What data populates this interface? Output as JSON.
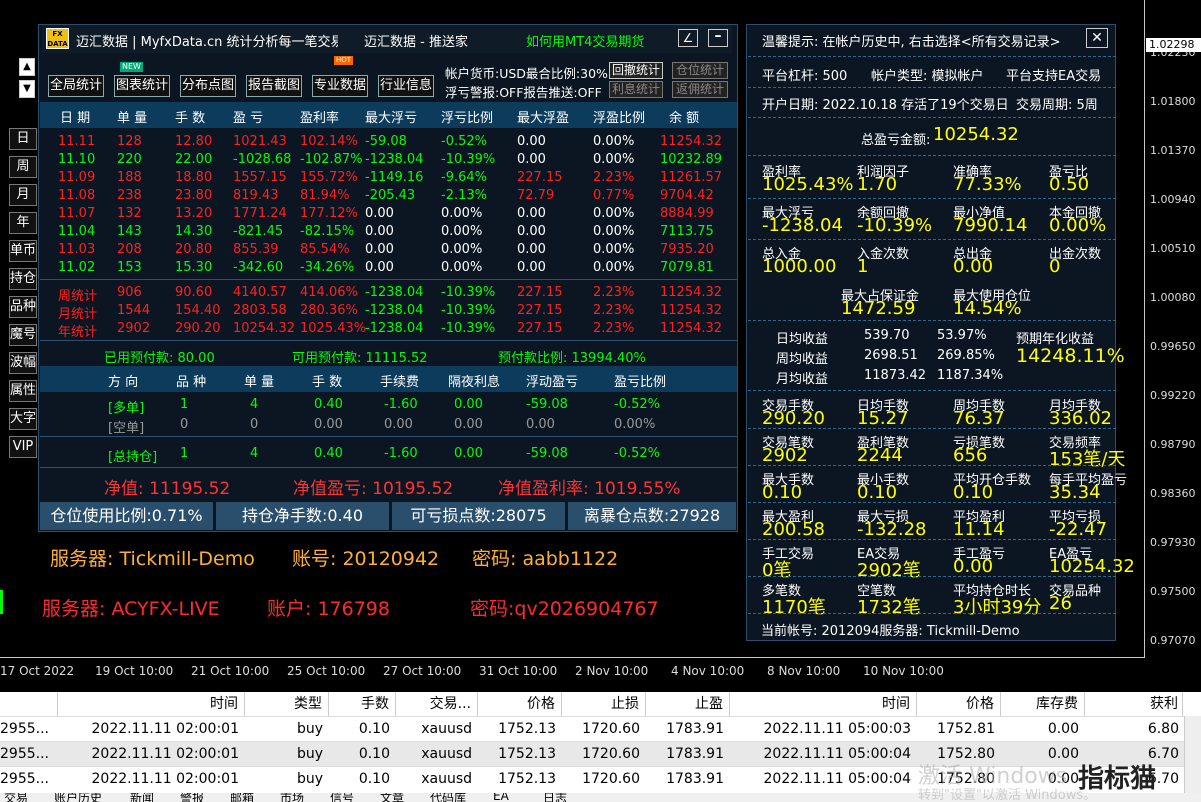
{
  "window": {
    "title": "迈汇数据 | MyfxData.cn  统计分析每一笔交易",
    "title2": "迈汇数据 - 推送家",
    "link": "如何用MT4交易期货",
    "logo": "FX\nDATA"
  },
  "price_axis": [
    "1.02298",
    "1.02230",
    "1.01800",
    "1.01370",
    "1.00940",
    "1.00510",
    "1.00080",
    "0.99650",
    "0.99220",
    "0.98790",
    "0.98360",
    "0.97930",
    "0.97500",
    "0.97070"
  ],
  "time_axis": [
    "17 Oct 2022",
    "19 Oct 10:00",
    "21 Oct 10:00",
    "25 Oct 10:00",
    "27 Oct 10:00",
    "31 Oct 10:00",
    "2 Nov 10:00",
    "4 Nov 10:00",
    "8 Nov 10:00",
    "10 Nov 10:00"
  ],
  "side_buttons": [
    "日",
    "周",
    "月",
    "年",
    "单币",
    "持仓",
    "品种",
    "魔号",
    "波幅",
    "属性",
    "大字",
    "VIP"
  ],
  "toolbar": {
    "buttons": [
      "全局统计",
      "图表统计",
      "分布点图",
      "报告截图",
      "专业数据",
      "行业信息"
    ],
    "new_badge": "NEW",
    "hot_badge": "HOT",
    "account_currency": "帐户货币:USD最合比例:30%",
    "float_warn": "浮亏警报:OFF报告推送:OFF",
    "btn_drawdown": "回撤统计",
    "btn_position": "仓位统计",
    "btn_profit": "利息统计",
    "btn_return": "返佣统计"
  },
  "stats_table": {
    "headers": [
      "日 期",
      "单 量",
      "手 数",
      "盈 亏",
      "盈利率",
      "最大浮亏",
      "浮亏比例",
      "最大浮盈",
      "浮盈比例",
      "余 额"
    ],
    "rows": [
      [
        "11.11",
        "128",
        "12.80",
        "1021.43",
        "102.14%",
        "-59.08",
        "-0.52%",
        "0.00",
        "0.00%",
        "11254.32"
      ],
      [
        "11.10",
        "220",
        "22.00",
        "-1028.68",
        "-102.87%",
        "-1238.04",
        "-10.39%",
        "0.00",
        "0.00%",
        "10232.89"
      ],
      [
        "11.09",
        "188",
        "18.80",
        "1557.15",
        "155.72%",
        "-1149.16",
        "-9.64%",
        "227.15",
        "2.23%",
        "11261.57"
      ],
      [
        "11.08",
        "238",
        "23.80",
        "819.43",
        "81.94%",
        "-205.43",
        "-2.13%",
        "72.79",
        "0.77%",
        "9704.42"
      ],
      [
        "11.07",
        "132",
        "13.20",
        "1771.24",
        "177.12%",
        "0.00",
        "0.00%",
        "0.00",
        "0.00%",
        "8884.99"
      ],
      [
        "11.04",
        "143",
        "14.30",
        "-821.45",
        "-82.15%",
        "0.00",
        "0.00%",
        "0.00",
        "0.00%",
        "7113.75"
      ],
      [
        "11.03",
        "208",
        "20.80",
        "855.39",
        "85.54%",
        "0.00",
        "0.00%",
        "0.00",
        "0.00%",
        "7935.20"
      ],
      [
        "11.02",
        "153",
        "15.30",
        "-342.60",
        "-34.26%",
        "0.00",
        "0.00%",
        "0.00",
        "0.00%",
        "7079.81"
      ]
    ],
    "summary": [
      [
        "周统计",
        "906",
        "90.60",
        "4140.57",
        "414.06%",
        "-1238.04",
        "-10.39%",
        "227.15",
        "2.23%",
        "11254.32"
      ],
      [
        "月统计",
        "1544",
        "154.40",
        "2803.58",
        "280.36%",
        "-1238.04",
        "-10.39%",
        "227.15",
        "2.23%",
        "11254.32"
      ],
      [
        "年统计",
        "2902",
        "290.20",
        "10254.32",
        "1025.43%",
        "-1238.04",
        "-10.39%",
        "227.15",
        "2.23%",
        "11254.32"
      ]
    ],
    "margin_used": "已用预付款: 80.00",
    "margin_free": "可用预付款: 11115.52",
    "margin_ratio": "预付款比例: 13994.40%"
  },
  "position_table": {
    "headers": [
      "方 向",
      "品 种",
      "单 量",
      "手 数",
      "手续费",
      "隔夜利息",
      "浮动盈亏",
      "盈亏比例"
    ],
    "rows": [
      [
        "[多单]",
        "1",
        "4",
        "0.40",
        "-1.60",
        "0.00",
        "-59.08",
        "-0.52%"
      ],
      [
        "[空单]",
        "0",
        "0",
        "0.00",
        "0.00",
        "0.00",
        "0.00",
        "0.00%"
      ],
      [
        "[总持仓]",
        "1",
        "4",
        "0.40",
        "-1.60",
        "0.00",
        "-59.08",
        "-0.52%"
      ]
    ]
  },
  "net": {
    "equity": "净值: 11195.52",
    "equity_profit": "净值盈亏: 10195.52",
    "equity_rate": "净值盈利率: 1019.55%"
  },
  "bottom_stats": [
    "仓位使用比例:0.71%",
    "持仓净手数:0.40",
    "可亏损点数:28075",
    "离暴仓点数:27928"
  ],
  "server1": {
    "server": "服务器: Tickmill-Demo",
    "account": "账号:  20120942",
    "password": "密码: aabb1122"
  },
  "server2": {
    "server": "服务器: ACYFX-LIVE",
    "account": "账户: 176798",
    "password": "密码:qv2026904767"
  },
  "right": {
    "tip": "温馨提示: 在帐户历史中, 右击选择<所有交易记录>",
    "close": "✕",
    "leverage": "平台杠杆: 500",
    "acct_type": "帐户类型: 模拟帐户",
    "ea": "平台支持EA交易",
    "open_date": "开户日期: 2022.10.18 存活了19个交易日",
    "period": "交易周期: 5周",
    "total_label": "总盈亏金额:",
    "total_value": "10254.32",
    "blocks": [
      [
        [
          "盈利率",
          "1025.43%"
        ],
        [
          "利润因子",
          "1.70"
        ],
        [
          "准确率",
          "77.33%"
        ],
        [
          "盈亏比",
          "0.50"
        ]
      ],
      [
        [
          "最大浮亏",
          "-1238.04"
        ],
        [
          "余额回撤",
          "-10.39%"
        ],
        [
          "最小净值",
          "7990.14"
        ],
        [
          "本金回撤",
          "0.00%"
        ]
      ],
      [
        [
          "总入金",
          "1000.00"
        ],
        [
          "入金次数",
          "1"
        ],
        [
          "总出金",
          "0.00"
        ],
        [
          "出金次数",
          "0"
        ]
      ]
    ],
    "max_margin_label": "最大占保证金",
    "max_margin": "1472.59",
    "max_pos_label": "最大使用仓位",
    "max_pos": "14.54%",
    "avg": [
      [
        "日均收益",
        "539.70",
        "53.97%"
      ],
      [
        "周均收益",
        "2698.51",
        "269.85%"
      ],
      [
        "月均收益",
        "11873.42",
        "1187.34%"
      ]
    ],
    "annual_label": "预期年化收益",
    "annual": "14248.11%",
    "blocks2": [
      [
        [
          "交易手数",
          "290.20"
        ],
        [
          "日均手数",
          "15.27"
        ],
        [
          "周均手数",
          "76.37"
        ],
        [
          "月均手数",
          "336.02"
        ]
      ],
      [
        [
          "交易笔数",
          "2902"
        ],
        [
          "盈利笔数",
          "2244"
        ],
        [
          "亏损笔数",
          "656"
        ],
        [
          "交易频率",
          "153笔/天"
        ]
      ],
      [
        [
          "最大手数",
          "0.10"
        ],
        [
          "最小手数",
          "0.10"
        ],
        [
          "平均开仓手数",
          "0.10"
        ],
        [
          "每手平均盈亏",
          "35.34"
        ]
      ],
      [
        [
          "最大盈利",
          "200.58"
        ],
        [
          "最大亏损",
          "-132.28"
        ],
        [
          "平均盈利",
          "11.14"
        ],
        [
          "平均亏损",
          "-22.47"
        ]
      ],
      [
        [
          "手工交易",
          "0笔"
        ],
        [
          "EA交易",
          "2902笔"
        ],
        [
          "手工盈亏",
          "0.00"
        ],
        [
          "EA盈亏",
          "10254.32"
        ]
      ],
      [
        [
          "多笔数",
          "1170笔"
        ],
        [
          "空笔数",
          "1732笔"
        ],
        [
          "平均持仓时长",
          "3小时39分"
        ],
        [
          "交易品种",
          "26"
        ]
      ]
    ],
    "current": "当前帐号: 2012094服务器: Tickmill-Demo"
  },
  "history": {
    "headers": [
      "时间",
      "类型",
      "手数",
      "交易...",
      "价格",
      "止损",
      "止盈",
      "时间",
      "价格",
      "库存费",
      "获利"
    ],
    "rows": [
      [
        "2955...",
        "2022.11.11 02:00:01",
        "buy",
        "0.10",
        "xauusd",
        "1752.13",
        "1720.60",
        "1783.91",
        "2022.11.11 05:00:03",
        "1752.81",
        "0.00",
        "6.80"
      ],
      [
        "2955...",
        "2022.11.11 02:00:01",
        "buy",
        "0.10",
        "xauusd",
        "1752.13",
        "1720.60",
        "1783.91",
        "2022.11.11 05:00:04",
        "1752.80",
        "0.00",
        "6.70"
      ],
      [
        "2955...",
        "2022.11.11 02:00:01",
        "buy",
        "0.10",
        "xauusd",
        "1752.13",
        "1720.60",
        "1783.91",
        "2022.11.11 05:00:04",
        "1752.80",
        "0.00",
        "6.70"
      ]
    ],
    "tabs": [
      "交易",
      "账户历史",
      "新闻",
      "警报",
      "邮箱",
      "市场",
      "信号",
      "文章",
      "代码库",
      "EA",
      "日志"
    ]
  },
  "watermark": {
    "text1": "激活 Windows",
    "text2": "转到\"设置\"以激活 Windows。",
    "brand": "指标猫"
  }
}
